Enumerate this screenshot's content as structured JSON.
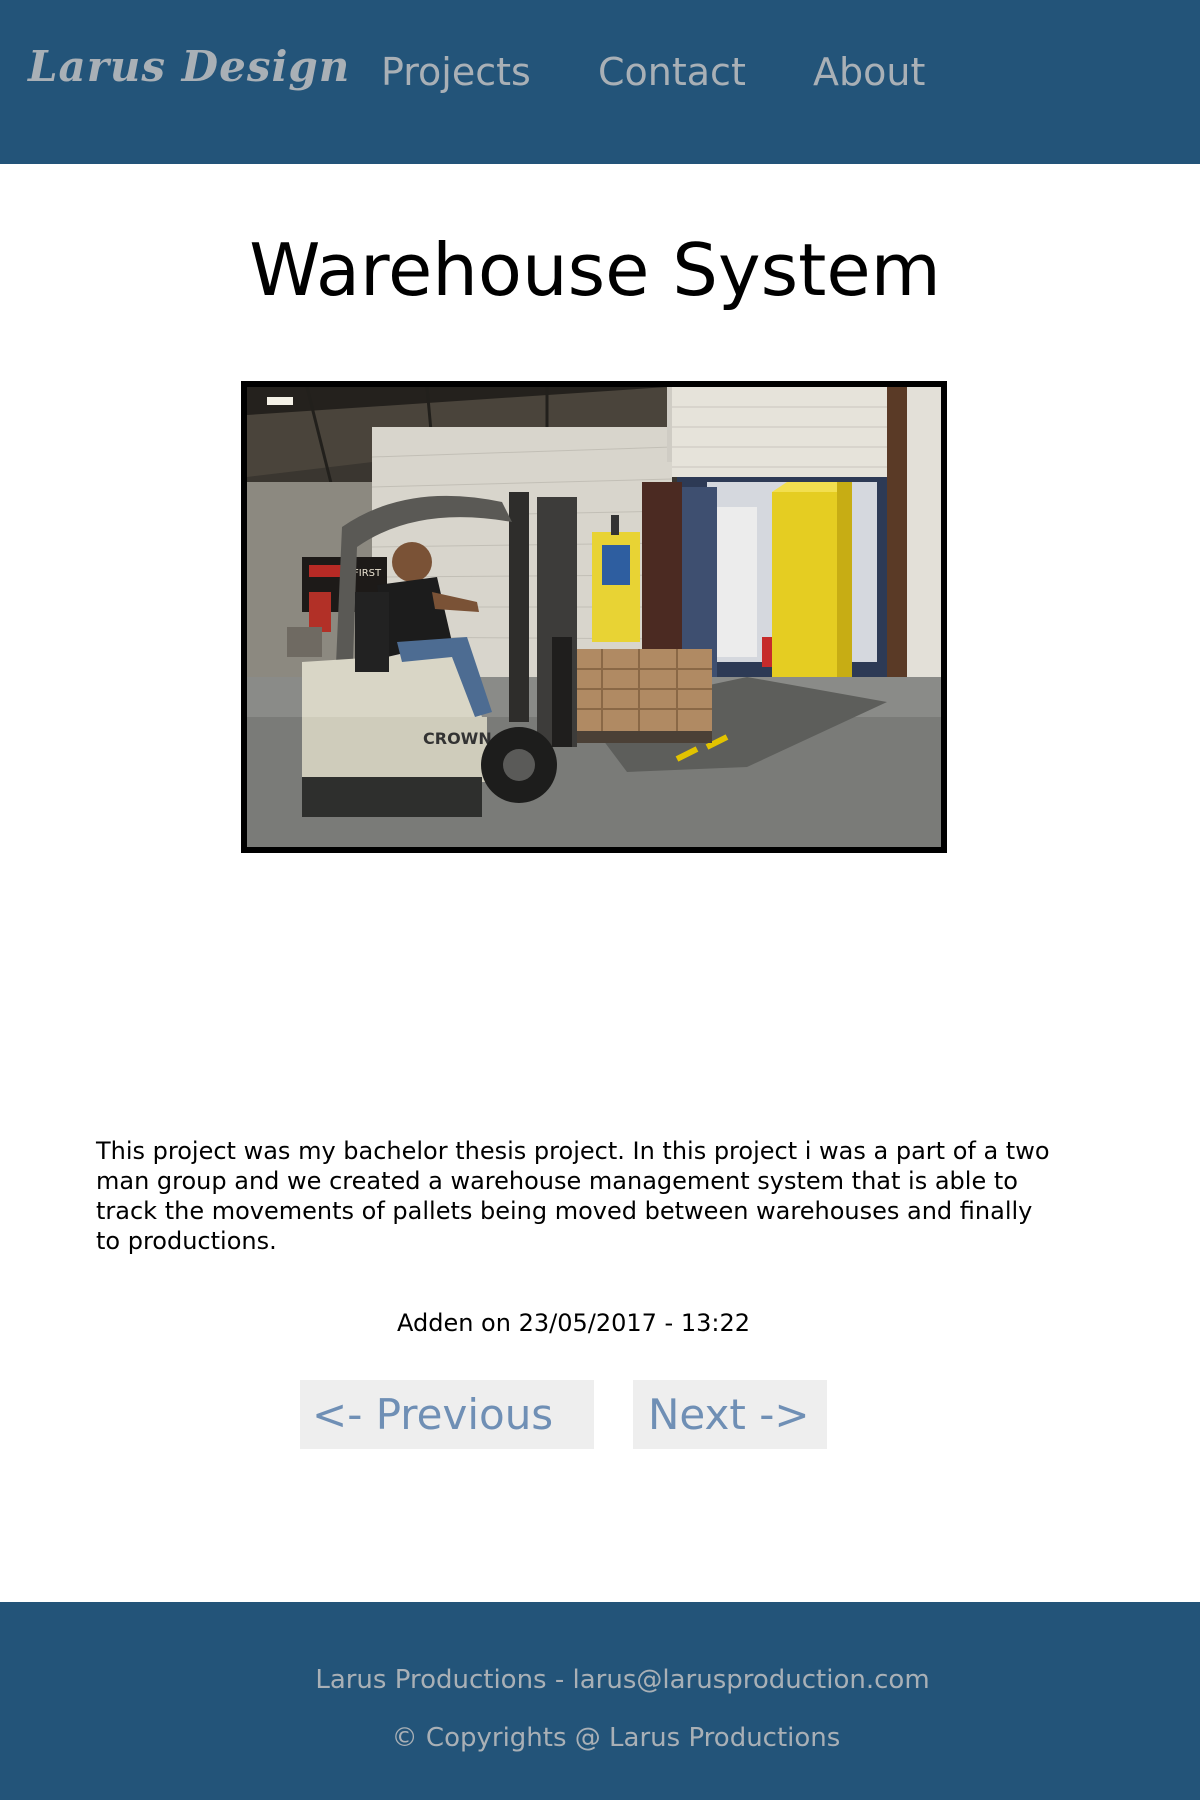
{
  "header": {
    "brand": "Larus Design",
    "nav": {
      "projects": "Projects",
      "contact": "Contact",
      "about": "About"
    }
  },
  "main": {
    "title": "Warehouse System",
    "description": "This project was my bachelor thesis project. In this project i was a part of a two\nman group and we created a warehouse management system that is able to\ntrack the movements of pallets being moved between warehouses and finally\n to productions.",
    "added": "Adden on 23/05/2017 - 13:22",
    "previous_label": "<- Previous",
    "next_label": "Next ->"
  },
  "photo": {
    "forklift_brand": "CROWN",
    "sign_text": "FIRST"
  },
  "footer": {
    "contact": "Larus Productions - larus@larusproduction.com",
    "copyright": "© Copyrights @ Larus Productions"
  },
  "colors": {
    "header_bg": "#235479",
    "header_text": "#a9b0b6",
    "button_bg": "#eeeeee",
    "button_text": "#6f8fb5"
  }
}
